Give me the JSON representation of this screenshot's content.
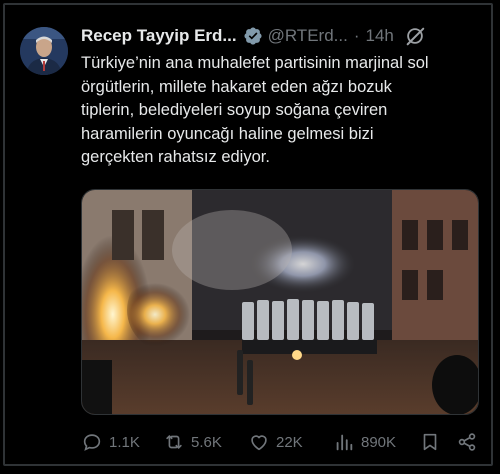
{
  "post": {
    "author_name": "Recep Tayyip Erd...",
    "handle": "@RTErd...",
    "separator": "·",
    "time": "14h",
    "text_lines": [
      "Türkiye’nin ana muhalefet partisinin marjinal sol",
      "örgütlerin, millete hakaret eden ağzı bozuk",
      "tiplerin, belediyeleri soyup soğana çeviren",
      "haramilerin oyuncağı haline gelmesi bizi",
      "gerçekten rahatsız ediyor."
    ]
  },
  "actions": {
    "replies": "1.1K",
    "reposts": "5.6K",
    "likes": "22K",
    "views": "890K"
  },
  "icons": {
    "verified": "verified-badge-icon",
    "grok": "grok-icon",
    "reply": "reply-icon",
    "repost": "repost-icon",
    "like": "heart-icon",
    "views": "views-icon",
    "bookmark": "bookmark-icon",
    "share": "share-icon"
  },
  "colors": {
    "background": "#000000",
    "text": "#e7e9ea",
    "muted": "#71767b",
    "verified": "#829aab"
  }
}
